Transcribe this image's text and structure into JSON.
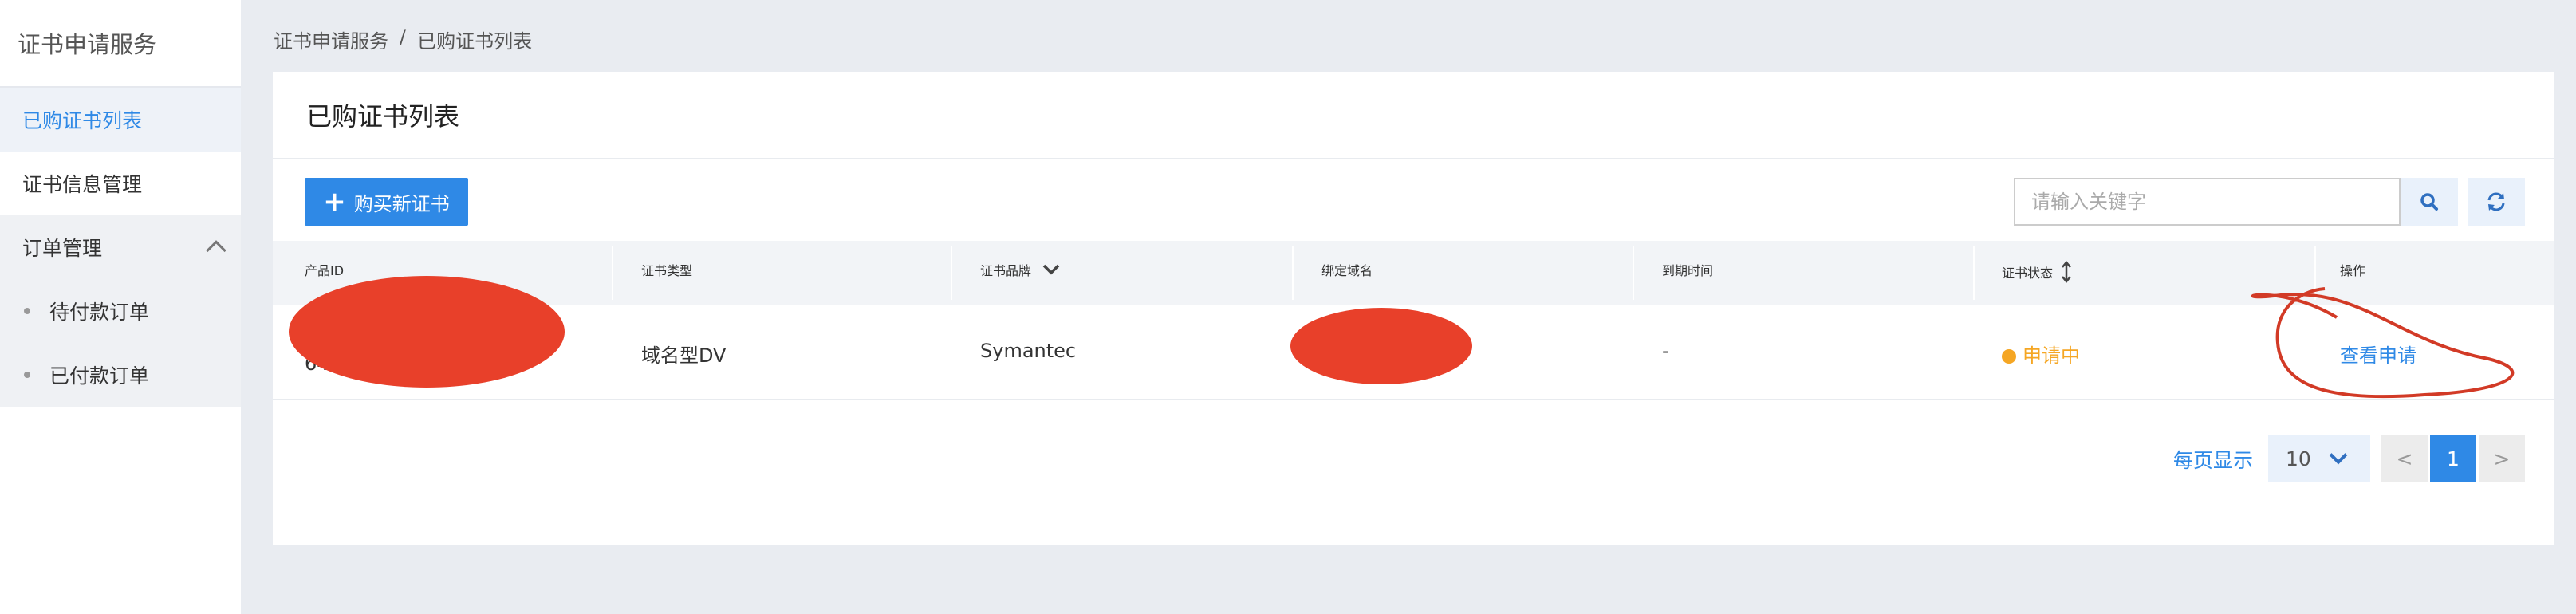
{
  "sidebar": {
    "title": "证书申请服务",
    "items": [
      {
        "label": "已购证书列表",
        "active": true
      },
      {
        "label": "证书信息管理",
        "active": false
      }
    ],
    "group": {
      "label": "订单管理",
      "children": [
        {
          "label": "待付款订单"
        },
        {
          "label": "已付款订单"
        }
      ]
    }
  },
  "breadcrumb": {
    "root": "证书申请服务",
    "separator": "/",
    "current": "已购证书列表"
  },
  "page": {
    "title": "已购证书列表"
  },
  "toolbar": {
    "buy_label": "购买新证书",
    "search_placeholder": "请输入关键字"
  },
  "table": {
    "columns": [
      "产品ID",
      "证书类型",
      "证书品牌",
      "绑定域名",
      "到期时间",
      "证书状态",
      "操作"
    ],
    "rows": [
      {
        "id": "64",
        "type": "域名型DV",
        "brand": "Symantec",
        "domain": "",
        "expiry": "-",
        "status": "申请中",
        "action": "查看申请"
      }
    ]
  },
  "pagination": {
    "per_page_label": "每页显示",
    "page_size": "10",
    "prev": "<",
    "current": "1",
    "next": ">"
  },
  "colors": {
    "accent": "#2f89e6",
    "status_pending": "#f5a623",
    "redaction": "#e8402a"
  }
}
